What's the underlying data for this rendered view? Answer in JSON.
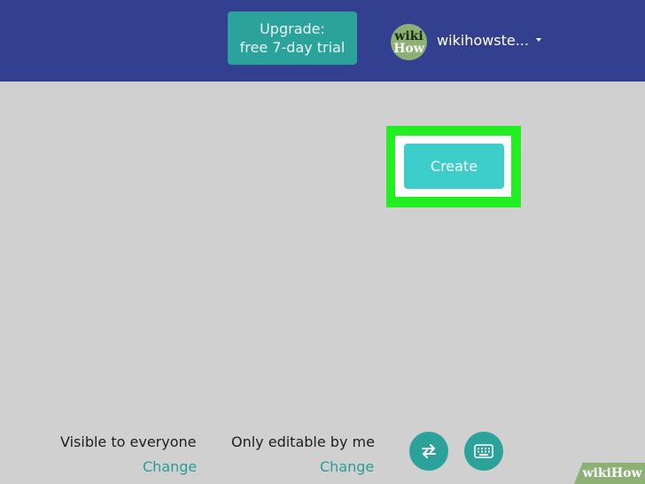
{
  "header": {
    "upgrade_line1": "Upgrade:",
    "upgrade_line2": "free 7-day trial",
    "avatar_text_top": "wiki",
    "avatar_text_bottom": "How",
    "username": "wikihowste..."
  },
  "main": {
    "create_label": "Create"
  },
  "footer": {
    "visibility_label": "Visible to everyone",
    "visibility_change": "Change",
    "edit_label": "Only editable by me",
    "edit_change": "Change"
  },
  "watermark": {
    "wiki": "wiki",
    "how": "How"
  },
  "icons": {
    "swap": "swap-arrows-icon",
    "keyboard": "keyboard-icon",
    "caret": "caret-down-icon"
  },
  "colors": {
    "header_bg": "#33408f",
    "accent": "#2ba39b",
    "create_bg": "#3dcdcb",
    "highlight": "#22ee22",
    "background": "#d0d0d0"
  }
}
